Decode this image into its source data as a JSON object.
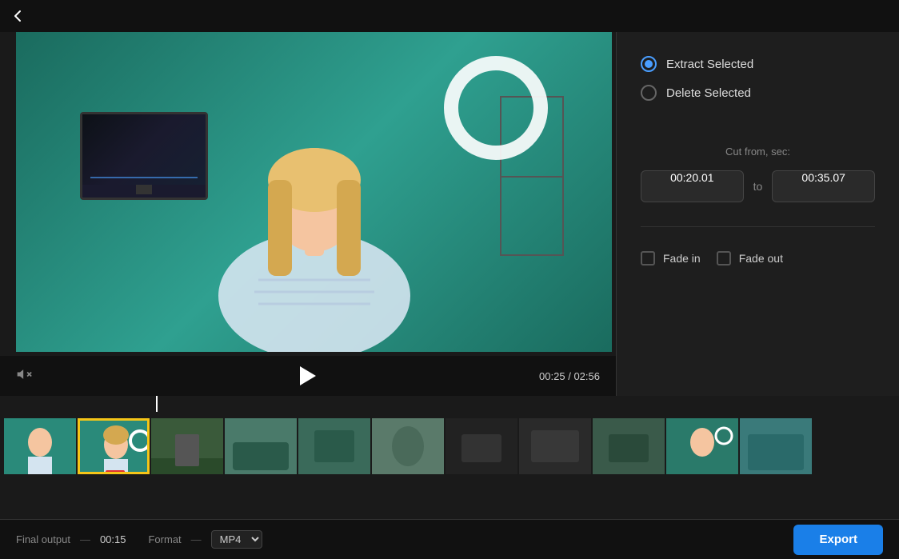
{
  "topbar": {
    "back_icon": "chevron-left"
  },
  "controls": {
    "play_icon": "play",
    "volume_icon": "volume-mute",
    "current_time": "00:25",
    "total_time": "02:56",
    "time_separator": "/"
  },
  "right_panel": {
    "extract_label": "Extract Selected",
    "delete_label": "Delete Selected",
    "cut_from_label": "Cut from, sec:",
    "start_time": "00:20.01",
    "end_time": "00:35.07",
    "to_label": "to",
    "fade_in_label": "Fade in",
    "fade_out_label": "Fade out"
  },
  "bottom_bar": {
    "final_output_label": "Final output",
    "output_separator": "—",
    "output_duration": "00:15",
    "format_label": "Format",
    "format_separator": "—",
    "format_value": "MP4",
    "export_label": "Export"
  }
}
